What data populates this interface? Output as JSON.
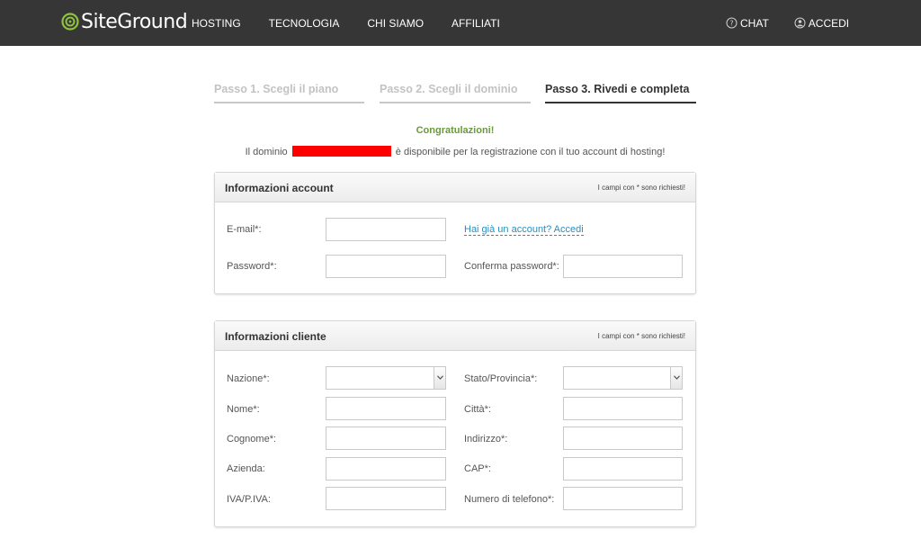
{
  "brand": {
    "logo_text": "SiteGround"
  },
  "nav": {
    "left": [
      "HOSTING",
      "TECNOLOGIA",
      "CHI SIAMO",
      "AFFILIATI"
    ],
    "chat": "CHAT",
    "login": "ACCEDI"
  },
  "steps": [
    {
      "label": "Passo 1. Scegli il piano",
      "state": "done"
    },
    {
      "label": "Passo 2. Scegli il dominio",
      "state": "done"
    },
    {
      "label": "Passo 3. Rivedi e completa",
      "state": "active"
    }
  ],
  "message": {
    "title": "Congratulazioni!",
    "prefix": "Il dominio",
    "suffix": "è disponibile per la registrazione con il tuo account di hosting!"
  },
  "account_panel": {
    "title": "Informazioni account",
    "note": "I campi con * sono richiesti!",
    "email_label": "E-mail*:",
    "password_label": "Password*:",
    "login_link": "Hai già un account? Accedi",
    "confirm_label": "Conferma password*:"
  },
  "customer_panel": {
    "title": "Informazioni cliente",
    "note": "I campi con * sono richiesti!",
    "labels_left": [
      "Nazione*:",
      "Nome*:",
      "Cognome*:",
      "Azienda:",
      "IVA/P.IVA:"
    ],
    "labels_right": [
      "Stato/Provincia*:",
      "Città*:",
      "Indirizzo*:",
      "CAP*:",
      "Numero di telefono*:"
    ]
  },
  "colors": {
    "topbar": "#363636",
    "success": "#6a9a3a",
    "link": "#2a8fbd",
    "redaction": "#ff0000"
  }
}
